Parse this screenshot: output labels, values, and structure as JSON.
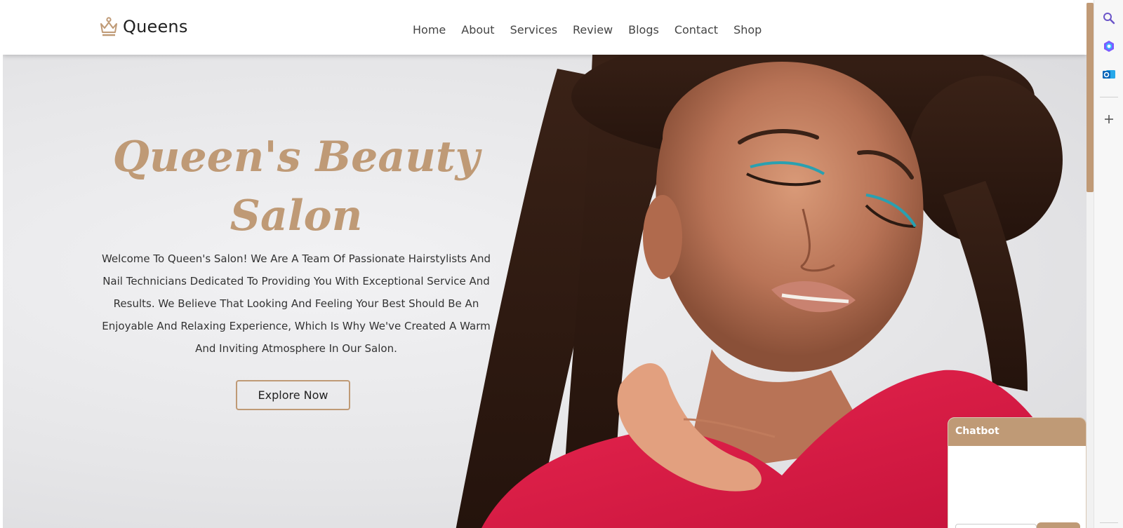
{
  "brand": {
    "icon": "crown-icon",
    "name": "Queens",
    "color": "#bf9a76"
  },
  "nav": {
    "items": [
      {
        "label": "Home"
      },
      {
        "label": "About"
      },
      {
        "label": "Services"
      },
      {
        "label": "Review"
      },
      {
        "label": "Blogs"
      },
      {
        "label": "Contact"
      },
      {
        "label": "Shop"
      }
    ]
  },
  "hero": {
    "title_line1": "Queen's Beauty",
    "title_line2": "Salon",
    "description": "Welcome To Queen's Salon! We Are A Team Of Passionate Hairstylists And Nail Technicians Dedicated To Providing You With Exceptional Service And Results. We Believe That Looking And Feeling Your Best Should Be An Enjoyable And Relaxing Experience, Which Is Why We've Created A Warm And Inviting Atmosphere In Our Salon.",
    "cta_label": "Explore Now",
    "image": "woman-portrait-photo"
  },
  "chatbot": {
    "title": "Chatbot"
  },
  "browser_sidebar": {
    "icons": [
      "search-icon",
      "copilot-icon",
      "outlook-icon",
      "add-icon"
    ]
  },
  "colors": {
    "accent": "#bf9a76",
    "text": "#333333",
    "hero_bg": "#e9e9eb"
  }
}
